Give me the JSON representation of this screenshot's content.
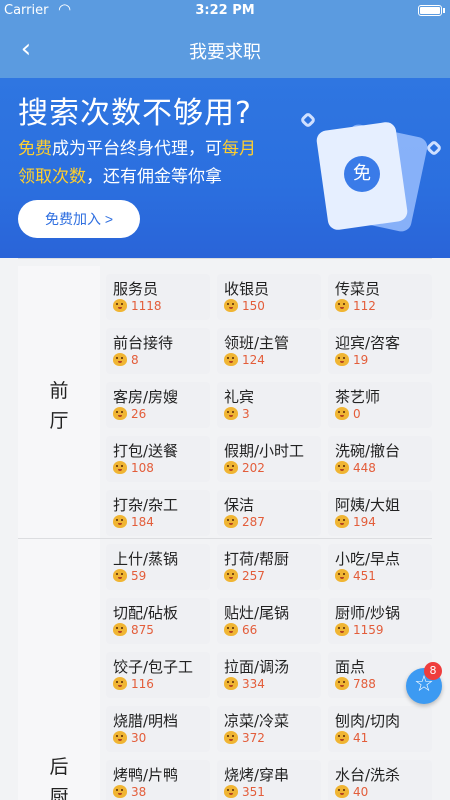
{
  "status_bar": {
    "carrier": "Carrier",
    "time": "3:22 PM"
  },
  "nav": {
    "title": "我要求职"
  },
  "banner": {
    "title": "搜索次数不够用?",
    "line1_hl1": "免费",
    "line1_rest": "成为平台终身代理，可",
    "line1_hl2": "每月",
    "line2_hl": "领取次数",
    "line2_rest": "，还有佣金等你拿",
    "join_label": "免费加入 >",
    "ticket_text": "免"
  },
  "categories": [
    {
      "label": "前\n厅",
      "jobs": [
        {
          "title": "服务员",
          "count": "1118"
        },
        {
          "title": "收银员",
          "count": "150"
        },
        {
          "title": "传菜员",
          "count": "112"
        },
        {
          "title": "前台接待",
          "count": "8"
        },
        {
          "title": "领班/主管",
          "count": "124"
        },
        {
          "title": "迎宾/咨客",
          "count": "19"
        },
        {
          "title": "客房/房嫂",
          "count": "26"
        },
        {
          "title": "礼宾",
          "count": "3"
        },
        {
          "title": "茶艺师",
          "count": "0"
        },
        {
          "title": "打包/送餐",
          "count": "108"
        },
        {
          "title": "假期/小时工",
          "count": "202"
        },
        {
          "title": "洗碗/撤台",
          "count": "448"
        },
        {
          "title": "打杂/杂工",
          "count": "184"
        },
        {
          "title": "保洁",
          "count": "287"
        },
        {
          "title": "阿姨/大姐",
          "count": "194"
        }
      ]
    },
    {
      "label": "后\n厨",
      "jobs": [
        {
          "title": "上什/蒸锅",
          "count": "59"
        },
        {
          "title": "打荷/帮厨",
          "count": "257"
        },
        {
          "title": "小吃/早点",
          "count": "451"
        },
        {
          "title": "切配/砧板",
          "count": "875"
        },
        {
          "title": "贴灶/尾锅",
          "count": "66"
        },
        {
          "title": "厨师/炒锅",
          "count": "1159"
        },
        {
          "title": "饺子/包子工",
          "count": "116"
        },
        {
          "title": "拉面/调汤",
          "count": "334"
        },
        {
          "title": "面点",
          "count": "788"
        },
        {
          "title": "烧腊/明档",
          "count": "30"
        },
        {
          "title": "凉菜/冷菜",
          "count": "372"
        },
        {
          "title": "刨肉/切肉",
          "count": "41"
        },
        {
          "title": "烤鸭/片鸭",
          "count": "38"
        },
        {
          "title": "烧烤/穿串",
          "count": "351"
        },
        {
          "title": "水台/洗杀",
          "count": "40"
        }
      ]
    }
  ],
  "fab": {
    "badge": "8"
  },
  "colors": {
    "nav": "#5b9be0",
    "banner": "#2f76e1",
    "accent_yellow": "#ffcf2e",
    "count_red": "#e35d3a"
  }
}
